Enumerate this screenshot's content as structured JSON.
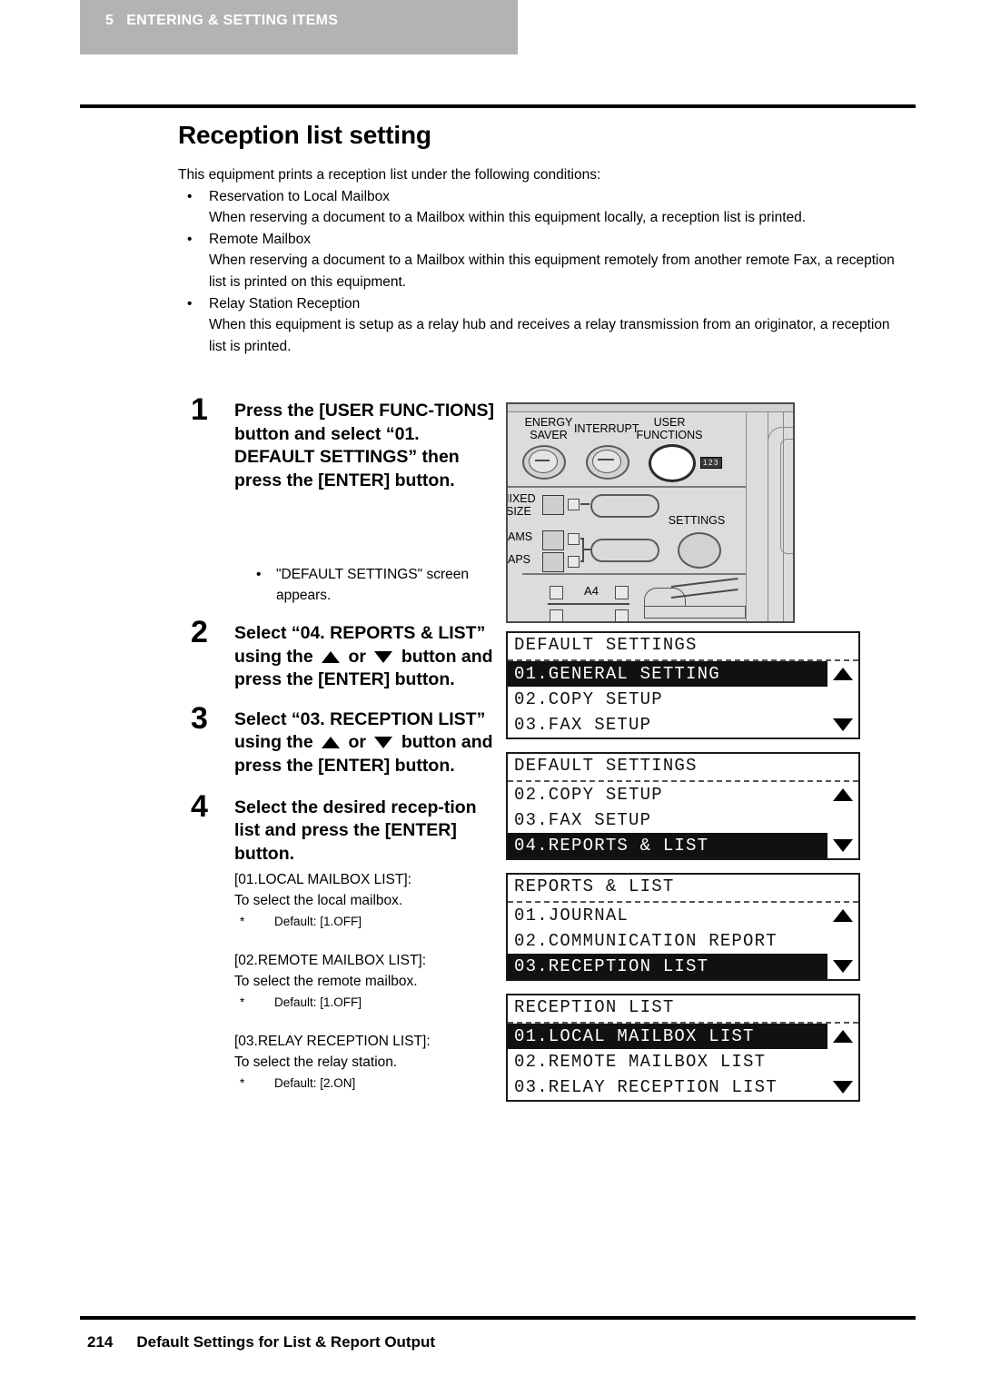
{
  "header": {
    "chapter_number": "5",
    "chapter_title": "ENTERING & SETTING ITEMS"
  },
  "page_title": "Reception list setting",
  "intro": {
    "lead": "This equipment prints a reception list under the following conditions:",
    "items": [
      {
        "bullet": "Reservation to Local Mailbox",
        "detail": "When reserving a document to a Mailbox within this equipment locally, a reception list is printed."
      },
      {
        "bullet": "Remote Mailbox",
        "detail": "When reserving a document to a Mailbox within this equipment remotely from another remote Fax, a reception list is printed on this equipment."
      },
      {
        "bullet": "Relay Station Reception",
        "detail": "When this equipment is setup as a relay hub and receives a relay transmission from an originator, a reception list is printed."
      }
    ]
  },
  "steps": [
    {
      "number": "1",
      "text_part1": "Press the [USER FUNC-TIONS] button and select “01. DEFAULT SETTINGS” then press the [ENTER] button.",
      "note": "\"DEFAULT SETTINGS\" screen appears."
    },
    {
      "number": "2",
      "text_a": "Select “04. REPORTS & LIST” using the",
      "text_or": "or",
      "text_b": "button and press the [ENTER] button."
    },
    {
      "number": "3",
      "text_a": "Select “03. RECEPTION LIST” using the",
      "text_or": "or",
      "text_b": "button and press the [ENTER] button."
    },
    {
      "number": "4",
      "text": "Select the desired recep-tion list and press the [ENTER] button.",
      "descriptions": [
        {
          "label": "[01.LOCAL MAILBOX LIST]:",
          "desc": "To select the local mailbox.",
          "star": "*",
          "default": "Default: [1.OFF]"
        },
        {
          "label": "[02.REMOTE MAILBOX LIST]:",
          "desc": "To select the remote mailbox.",
          "star": "*",
          "default": "Default: [1.OFF]"
        },
        {
          "label": "[03.RELAY RECEPTION LIST]:",
          "desc": "To select the relay station.",
          "star": "*",
          "default": "Default: [2.ON]"
        }
      ]
    }
  ],
  "control_panel": {
    "labels": {
      "energy_saver_l1": "ENERGY",
      "energy_saver_l2": "SAVER",
      "interrupt": "INTERRUPT",
      "user_functions_l1": "USER",
      "user_functions_l2": "FUNCTIONS",
      "mixed_size_l1": "IIXED",
      "mixed_size_l2": "SIZE",
      "ams": "AMS",
      "aps": "APS",
      "settings": "SETTINGS",
      "counter_badge": "123",
      "paper_a4": "A4"
    }
  },
  "lcd_screens": [
    {
      "name": "default-settings-1",
      "title": "DEFAULT SETTINGS",
      "rows": [
        {
          "text": "01.GENERAL SETTING",
          "selected": true,
          "arrow": "up"
        },
        {
          "text": "02.COPY SETUP",
          "selected": false,
          "arrow": "none"
        },
        {
          "text": "03.FAX SETUP",
          "selected": false,
          "arrow": "down"
        }
      ]
    },
    {
      "name": "default-settings-2",
      "title": "DEFAULT SETTINGS",
      "rows": [
        {
          "text": "02.COPY SETUP",
          "selected": false,
          "arrow": "up"
        },
        {
          "text": "03.FAX SETUP",
          "selected": false,
          "arrow": "none"
        },
        {
          "text": "04.REPORTS & LIST",
          "selected": true,
          "arrow": "down"
        }
      ]
    },
    {
      "name": "reports-and-list",
      "title": "REPORTS & LIST",
      "rows": [
        {
          "text": "01.JOURNAL",
          "selected": false,
          "arrow": "up"
        },
        {
          "text": "02.COMMUNICATION REPORT",
          "selected": false,
          "arrow": "none"
        },
        {
          "text": "03.RECEPTION LIST",
          "selected": true,
          "arrow": "down"
        }
      ]
    },
    {
      "name": "reception-list",
      "title": "RECEPTION LIST",
      "rows": [
        {
          "text": "01.LOCAL MAILBOX LIST",
          "selected": true,
          "arrow": "up"
        },
        {
          "text": "02.REMOTE MAILBOX LIST",
          "selected": false,
          "arrow": "none"
        },
        {
          "text": "03.RELAY RECEPTION LIST",
          "selected": false,
          "arrow": "down"
        }
      ]
    }
  ],
  "footer": {
    "page_number": "214",
    "section": "Default Settings for List & Report Output"
  },
  "colors": {
    "band": "#b3b3b3",
    "panel_face": "#dcdcdc",
    "lcd_selected": "#111111"
  }
}
